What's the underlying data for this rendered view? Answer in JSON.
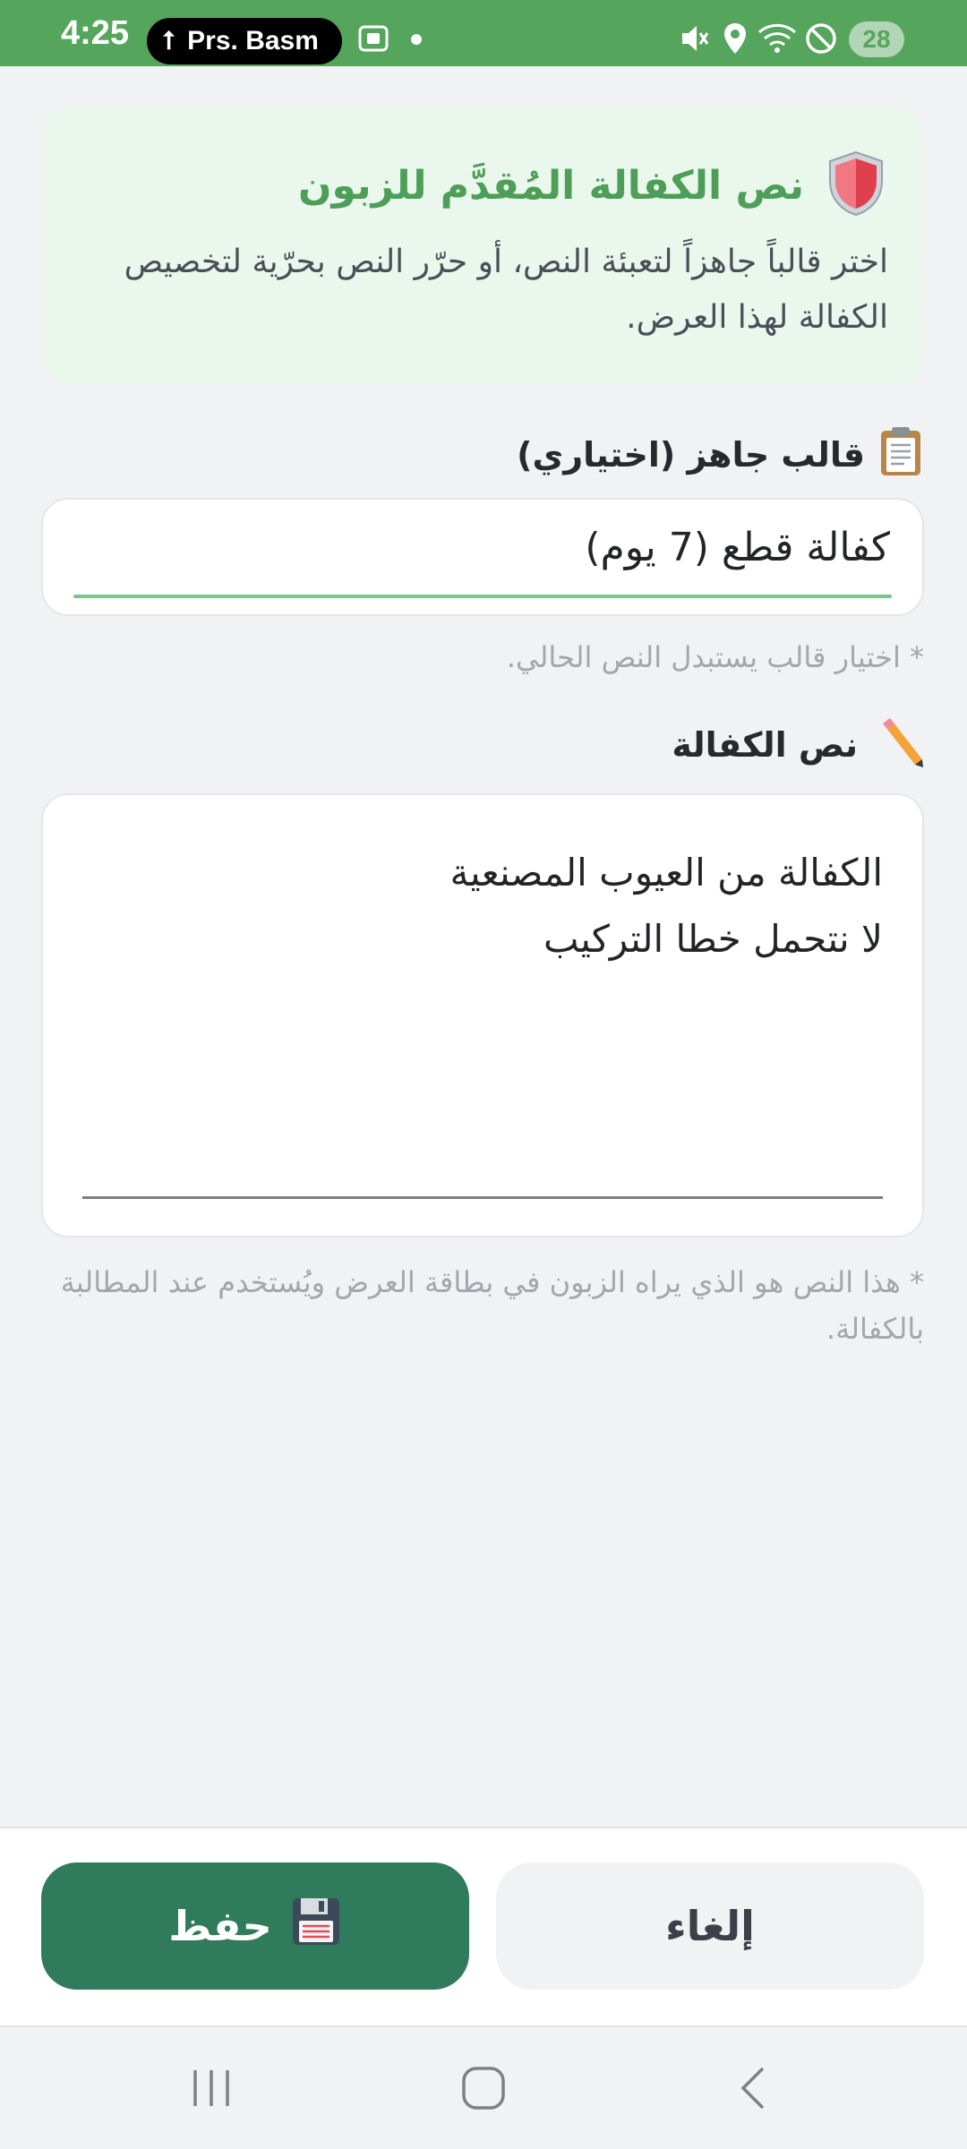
{
  "status_bar": {
    "time": "4:25",
    "notification_pill": "Prs. Basm",
    "battery": "28",
    "background_color": "#55a55c"
  },
  "info_card": {
    "icon": "shield-icon",
    "title": "نص الكفالة المُقدَّم للزبون",
    "description": "اختر قالباً جاهزاً لتعبئة النص، أو حرّر النص بحرّية لتخصيص الكفالة لهذا العرض."
  },
  "template_section": {
    "icon": "clipboard-icon",
    "label": "قالب جاهز (اختياري)",
    "selected_value": "كفالة قطع (7 يوم)",
    "hint": "* اختيار قالب يستبدل النص الحالي."
  },
  "warranty_section": {
    "icon": "pencil-icon",
    "label": "نص الكفالة",
    "text_value": "الكفالة من العيوب المصنعية\nلا نتحمل خطا التركيب",
    "hint": "* هذا النص هو الذي يراه الزبون في بطاقة العرض ويُستخدم عند المطالبة بالكفالة."
  },
  "actions": {
    "save_label": "حفظ",
    "save_icon": "floppy-disk-icon",
    "cancel_label": "إلغاء",
    "save_color": "#2f7b5b"
  },
  "nav_bar": {
    "recents_icon": "recents-icon",
    "home_icon": "home-icon",
    "back_icon": "back-icon"
  }
}
